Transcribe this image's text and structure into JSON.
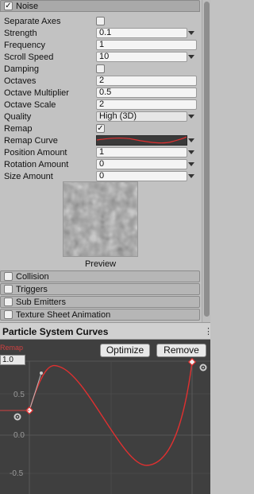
{
  "noise_module": {
    "title": "Noise",
    "enabled_check": "✓",
    "properties": [
      {
        "label": "Separate Axes",
        "type": "checkbox",
        "checked": false
      },
      {
        "label": "Strength",
        "type": "dropdown-field",
        "value": "0.1"
      },
      {
        "label": "Frequency",
        "type": "field",
        "value": "1"
      },
      {
        "label": "Scroll Speed",
        "type": "dropdown-field",
        "value": "10"
      },
      {
        "label": "Damping",
        "type": "checkbox",
        "checked": false
      },
      {
        "label": "Octaves",
        "type": "field",
        "value": "2"
      },
      {
        "label": "Octave Multiplier",
        "type": "field",
        "value": "0.5"
      },
      {
        "label": "Octave Scale",
        "type": "field",
        "value": "2"
      },
      {
        "label": "Quality",
        "type": "dropdown",
        "value": "High (3D)"
      },
      {
        "label": "Remap",
        "type": "checkbox",
        "checked": true
      },
      {
        "label": "Remap Curve",
        "type": "curve",
        "value": ""
      },
      {
        "label": "Position Amount",
        "type": "dropdown-field",
        "value": "1"
      },
      {
        "label": "Rotation Amount",
        "type": "dropdown-field",
        "value": "0"
      },
      {
        "label": "Size Amount",
        "type": "dropdown-field",
        "value": "0"
      }
    ],
    "preview_label": "Preview"
  },
  "collapsed_modules": [
    {
      "label": "Collision"
    },
    {
      "label": "Triggers"
    },
    {
      "label": "Sub Emitters"
    },
    {
      "label": "Texture Sheet Animation"
    }
  ],
  "curves_panel": {
    "title": "Particle System Curves",
    "menu_icon": "⋮",
    "optimize_label": "Optimize",
    "remove_label": "Remove",
    "curve_name": "Remap",
    "y_max": "1.0",
    "y_ticks": [
      "0.5",
      "0.0",
      "-0.5"
    ],
    "curve_color": "#e03030"
  },
  "icons": {
    "gear": "gear-icon",
    "checkmark": "✓"
  }
}
